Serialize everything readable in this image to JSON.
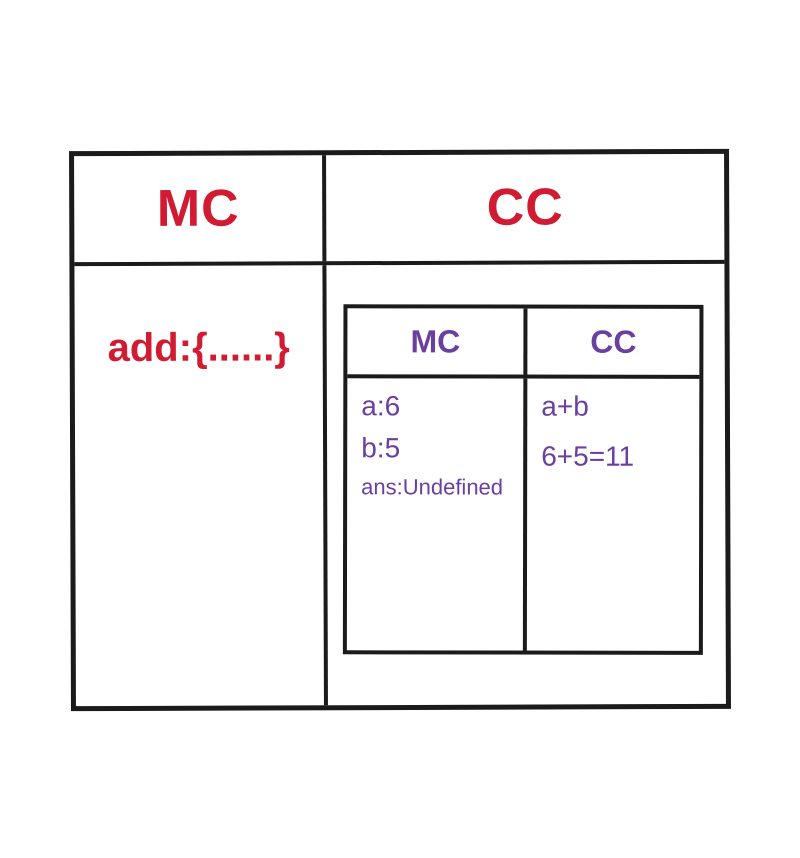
{
  "outer": {
    "left_header": "MC",
    "right_header": "CC",
    "left_body": "add:{......}"
  },
  "inner": {
    "left_header": "MC",
    "right_header": "CC",
    "left_body": {
      "line1": "a:6",
      "line2": "b:5",
      "line3": "ans:Undefined"
    },
    "right_body": {
      "line1": "a+b",
      "line2": "6+5=11"
    }
  },
  "chart_data": {
    "type": "table",
    "description": "Nested execution-context diagram. Outer table has columns MC and CC. MC column contains 'add:{......}'. CC column contains a nested table with its own MC and CC columns. Inner MC holds variable bindings a:6, b:5, ans:Undefined. Inner CC holds expression a+b and evaluation 6+5=11.",
    "outer_columns": [
      "MC",
      "CC"
    ],
    "outer_rows": [
      {
        "MC": "add:{......}",
        "CC": "<nested table>"
      }
    ],
    "inner_columns": [
      "MC",
      "CC"
    ],
    "inner_rows": [
      {
        "MC": "a:6",
        "CC": "a+b"
      },
      {
        "MC": "b:5",
        "CC": "6+5=11"
      },
      {
        "MC": "ans:Undefined",
        "CC": ""
      }
    ],
    "variables": {
      "a": 6,
      "b": 5,
      "ans": "Undefined"
    },
    "expression": "a+b",
    "evaluation": {
      "lhs": "6+5",
      "result": 11
    }
  }
}
